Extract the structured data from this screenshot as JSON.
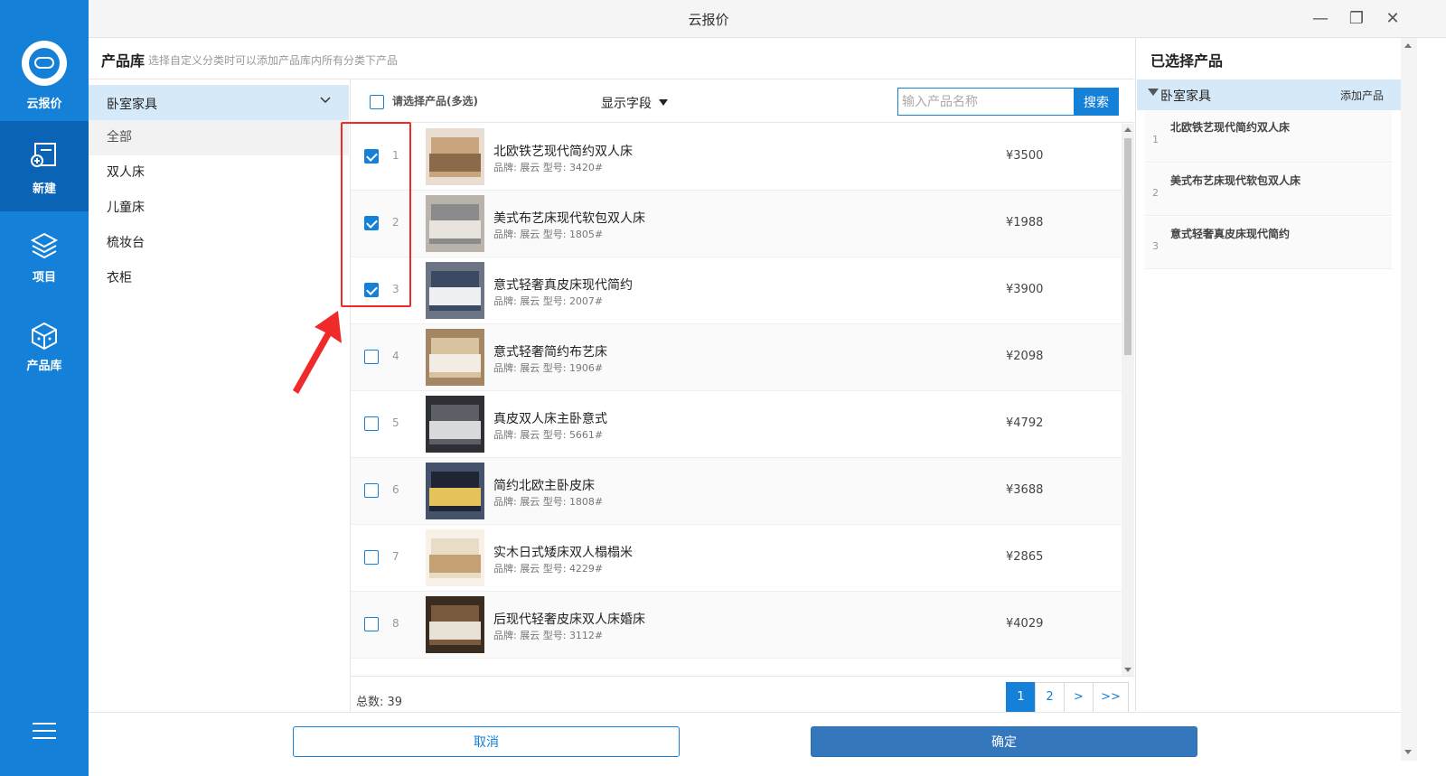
{
  "window": {
    "title": "云报价",
    "minimize_icon": "minimize-icon",
    "restore_icon": "restore-icon",
    "close_icon": "close-icon"
  },
  "rail": {
    "app_name": "云报价",
    "items": [
      {
        "label": "新建",
        "icon": "new-document-icon",
        "active": true
      },
      {
        "label": "项目",
        "icon": "layers-icon",
        "active": false
      },
      {
        "label": "产品库",
        "icon": "box-icon",
        "active": false
      }
    ],
    "menu_icon": "hamburger-menu-icon",
    "accent": "#1480d8"
  },
  "library": {
    "title": "产品库",
    "hint": "选择自定义分类时可以添加产品库内所有分类下产品"
  },
  "categories": {
    "group": "卧室家具",
    "items": [
      "全部",
      "双人床",
      "儿童床",
      "梳妆台",
      "衣柜"
    ],
    "selected": "全部"
  },
  "toolbar": {
    "select_all_label": "请选择产品(多选)",
    "fields_label": "显示字段",
    "search_placeholder": "输入产品名称",
    "search_button": "搜索"
  },
  "products": [
    {
      "num": "1",
      "name": "北欧铁艺现代简约双人床",
      "brand_label": "品牌:",
      "brand": "展云",
      "model_label": "型号:",
      "model": "3420#",
      "price": "¥3500",
      "checked": true
    },
    {
      "num": "2",
      "name": "美式布艺床现代软包双人床",
      "brand_label": "品牌:",
      "brand": "展云",
      "model_label": "型号:",
      "model": "1805#",
      "price": "¥1988",
      "checked": true
    },
    {
      "num": "3",
      "name": "意式轻奢真皮床现代简约",
      "brand_label": "品牌:",
      "brand": "展云",
      "model_label": "型号:",
      "model": "2007#",
      "price": "¥3900",
      "checked": true
    },
    {
      "num": "4",
      "name": "意式轻奢简约布艺床",
      "brand_label": "品牌:",
      "brand": "展云",
      "model_label": "型号:",
      "model": "1906#",
      "price": "¥2098",
      "checked": false
    },
    {
      "num": "5",
      "name": "真皮双人床主卧意式",
      "brand_label": "品牌:",
      "brand": "展云",
      "model_label": "型号:",
      "model": "5661#",
      "price": "¥4792",
      "checked": false
    },
    {
      "num": "6",
      "name": "简约北欧主卧皮床",
      "brand_label": "品牌:",
      "brand": "展云",
      "model_label": "型号:",
      "model": "1808#",
      "price": "¥3688",
      "checked": false
    },
    {
      "num": "7",
      "name": "实木日式矮床双人榻榻米",
      "brand_label": "品牌:",
      "brand": "展云",
      "model_label": "型号:",
      "model": "4229#",
      "price": "¥2865",
      "checked": false
    },
    {
      "num": "8",
      "name": "后现代轻奢皮床双人床婚床",
      "brand_label": "品牌:",
      "brand": "展云",
      "model_label": "型号:",
      "model": "3112#",
      "price": "¥4029",
      "checked": false
    }
  ],
  "footer": {
    "total_label": "总数:",
    "total": "39",
    "pages": [
      "1",
      "2",
      ">",
      ">>"
    ],
    "current_page": "1"
  },
  "selected_panel": {
    "title": "已选择产品",
    "group": "卧室家具",
    "add_label": "添加产品",
    "items": [
      {
        "num": "1",
        "name": "北欧铁艺现代简约双人床"
      },
      {
        "num": "2",
        "name": "美式布艺床现代软包双人床"
      },
      {
        "num": "3",
        "name": "意式轻奢真皮床现代简约"
      }
    ]
  },
  "actions": {
    "cancel": "取消",
    "confirm": "确定"
  },
  "annotation": {
    "color": "#f02a2a"
  }
}
